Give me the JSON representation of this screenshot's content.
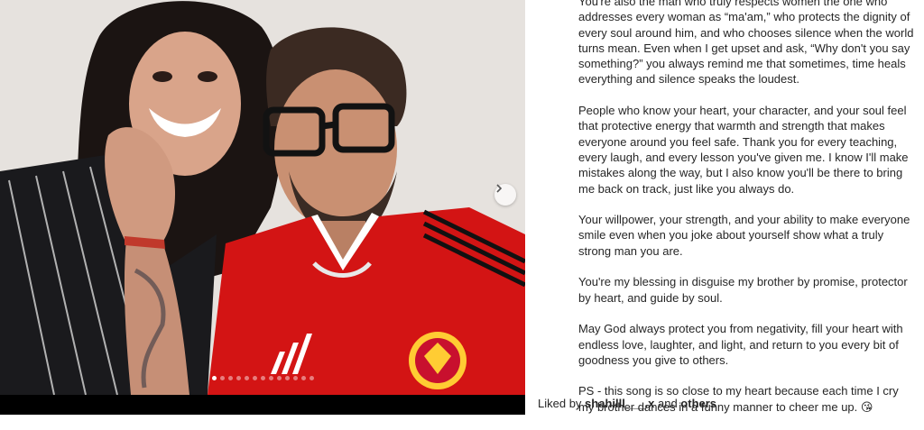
{
  "post": {
    "carousel": {
      "next_icon": "chevron-right-icon",
      "slide_count": 13,
      "active_index": 0
    },
    "caption": {
      "paragraphs": [
        "You're also the man who truly respects women the one who addresses every woman as “ma'am,” who protects the dignity of every soul around him, and who chooses silence when the world turns mean. Even when I get upset and ask, “Why don't you say something?” you always remind me that sometimes, time heals everything and silence speaks the loudest.",
        "People who know your heart, your character, and your soul feel that protective energy that warmth and strength that makes everyone around you feel safe. Thank you for every teaching, every laugh, and every lesson you've given me. I know I'll make mistakes along the way, but I also know you'll be there to bring me back on track, just like you always do.",
        "Your willpower, your strength, and your ability to make everyone smile even when you joke about yourself show what a truly strong man you are.",
        "You're my blessing in disguise my brother by promise, protector by heart, and guide by soul.",
        "May God always protect you from negativity, fill your heart with endless love, laughter, and light, and return to you every bit of goodness you give to others.",
        "PS - this song is so close to my heart because each time I cry my brother dances in a funny manner to cheer me up. 😘"
      ]
    },
    "likes": {
      "prefix": "Liked by ",
      "user": "shahilll___.x",
      "connector": " and ",
      "others": "others"
    }
  },
  "colors": {
    "text": "#262626",
    "jersey_red": "#d31414",
    "background": "#ffffff"
  }
}
